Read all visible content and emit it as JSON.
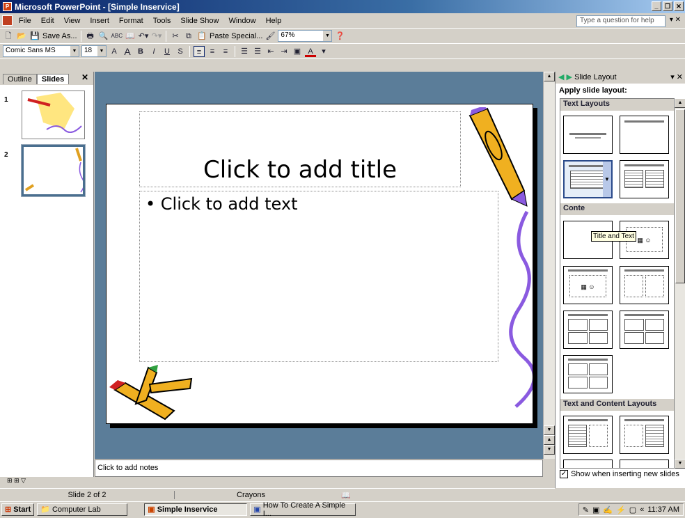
{
  "window": {
    "title": "Microsoft PowerPoint - [Simple Inservice]"
  },
  "menu": [
    "File",
    "Edit",
    "View",
    "Insert",
    "Format",
    "Tools",
    "Slide Show",
    "Window",
    "Help"
  ],
  "help_placeholder": "Type a question for help",
  "toolbar": {
    "save_as": "Save As...",
    "paste_special": "Paste Special...",
    "zoom": "67%"
  },
  "format": {
    "font": "Comic Sans MS",
    "size": "18"
  },
  "left_panel": {
    "tabs": [
      "Outline",
      "Slides"
    ],
    "thumb_numbers": [
      "1",
      "2"
    ]
  },
  "slide": {
    "title_placeholder": "Click to add title",
    "body_placeholder": "Click to add text",
    "bullet": "•"
  },
  "notes": "Click to add notes",
  "status": {
    "slide": "Slide 2 of 2",
    "design": "Crayons"
  },
  "task_pane": {
    "title": "Slide Layout",
    "apply": "Apply slide layout:",
    "sections": [
      "Text Layouts",
      "Content Layouts",
      "Text and Content Layouts"
    ],
    "visible_section_label": "Conte",
    "tooltip": "Title and Text",
    "checkbox": "Show when inserting new slides"
  },
  "taskbar": {
    "start": "Start",
    "items": [
      "Computer Lab",
      "Simple Inservice",
      "How To Create A Simple I..."
    ],
    "clock": "11:37 AM"
  }
}
